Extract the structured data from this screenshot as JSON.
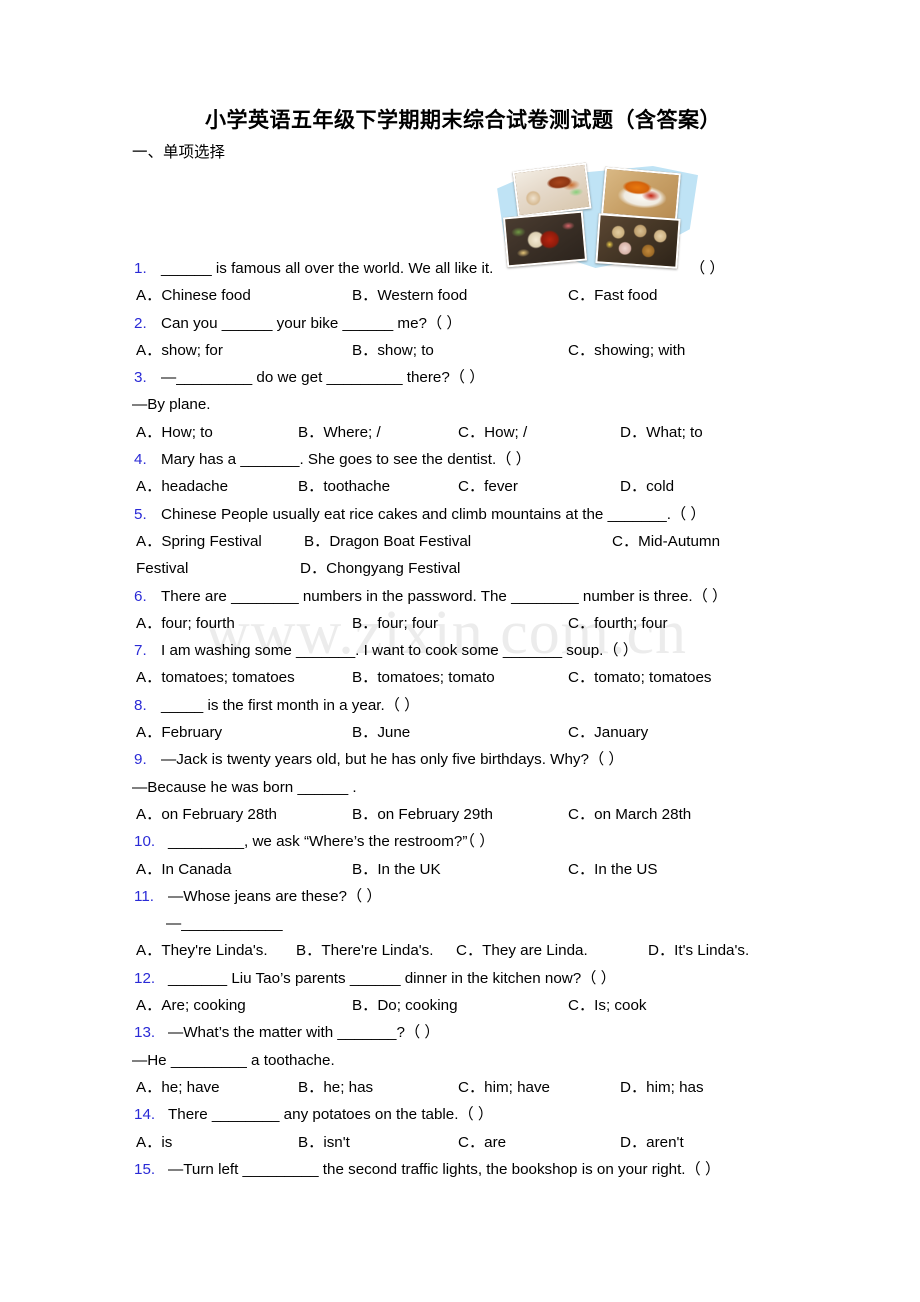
{
  "document": {
    "title": "小学英语五年级下学期期末综合试卷测试题（含答案）",
    "section_heading": "一、单项选择",
    "watermark": "www.zixin.com.cn"
  },
  "colors": {
    "question_number": "#2a2ad6",
    "text": "#000000",
    "banner_blue": "#bfe3f5",
    "watermark": "#ececec"
  },
  "collage": {
    "alt": "Chinese food collage on blue arrow banner",
    "photos": [
      {
        "name": "roast-duck-photo"
      },
      {
        "name": "spicy-chicken-photo"
      },
      {
        "name": "hot-pot-photo"
      },
      {
        "name": "dim-sum-photo"
      }
    ]
  },
  "questions": [
    {
      "num": "1.",
      "text": "______ is famous all over the world. We all like it.",
      "right_paren": "（ ）",
      "options": [
        "A．Chinese food",
        "B．Western food",
        "C．Fast food"
      ]
    },
    {
      "num": "2.",
      "text": "Can you ______ your bike ______ me?（  ）",
      "options": [
        "A．show; for",
        "B．show; to",
        "C．showing; with"
      ]
    },
    {
      "num": "3.",
      "text": "—_________ do we get _________ there?（   ）",
      "cont": "—By plane.",
      "options": [
        "A．How; to",
        "B．Where; /",
        "C．How; /",
        "D．What; to"
      ]
    },
    {
      "num": "4.",
      "text": "Mary has a _______. She goes to see the dentist.（ ）",
      "options": [
        "A．headache",
        "B．toothache",
        "C．fever",
        "D．cold"
      ]
    },
    {
      "num": "5.",
      "text": "Chinese People usually eat rice cakes and climb mountains at the _______.（ ）",
      "options_row1": [
        "A．Spring Festival",
        "B．Dragon Boat Festival",
        "C．Mid-Autumn"
      ],
      "options_row2": [
        "Festival",
        "D．Chongyang Festival"
      ]
    },
    {
      "num": "6.",
      "text": "There are ________ numbers in the password. The ________ number is three.（  ）",
      "options": [
        "A．four; fourth",
        "B．four; four",
        "C．fourth; four"
      ]
    },
    {
      "num": "7.",
      "text": "I am washing some _______. I want to cook some _______ soup.（  ）",
      "options": [
        "A．tomatoes; tomatoes",
        "B．tomatoes; tomato",
        "C．tomato; tomatoes"
      ]
    },
    {
      "num": "8.",
      "text": "_____ is the first month in a year.（  ）",
      "options": [
        "A．February",
        "B．June",
        "C．January"
      ]
    },
    {
      "num": "9.",
      "text": "—Jack is twenty years old, but he has only five birthdays. Why?（ ）",
      "cont": "—Because he was born ______ .",
      "options": [
        "A．on February 28th",
        "B．on February 29th",
        "C．on March 28th"
      ]
    },
    {
      "num": "10.",
      "text": "_________, we ask “Where’s the restroom?”（ ）",
      "options": [
        "A．In Canada",
        "B．In the UK",
        "C．In the US"
      ]
    },
    {
      "num": "11.",
      "text": "—Whose jeans are these?（ ）",
      "cont": "—____________",
      "options": [
        "A．They're Linda's.",
        "B．There're Linda's.",
        "C．They are Linda.",
        "D．It's Linda's."
      ]
    },
    {
      "num": "12.",
      "text": "_______ Liu Tao’s parents ______ dinner in the kitchen now?（ ）",
      "options": [
        "A．Are; cooking",
        "B．Do; cooking",
        "C．Is; cook"
      ]
    },
    {
      "num": "13.",
      "text": "—What’s the matter with _______?（ ）",
      "cont": "—He _________ a toothache.",
      "options": [
        "A．he; have",
        "B．he; has",
        "C．him; have",
        "D．him; has"
      ]
    },
    {
      "num": "14.",
      "text": "There ________ any potatoes on the table.（ ）",
      "options": [
        "A．is",
        "B．isn't",
        "C．are",
        "D．aren't"
      ]
    },
    {
      "num": "15.",
      "text": "—Turn left _________ the second traffic lights, the bookshop is on your right.（ ）"
    }
  ]
}
